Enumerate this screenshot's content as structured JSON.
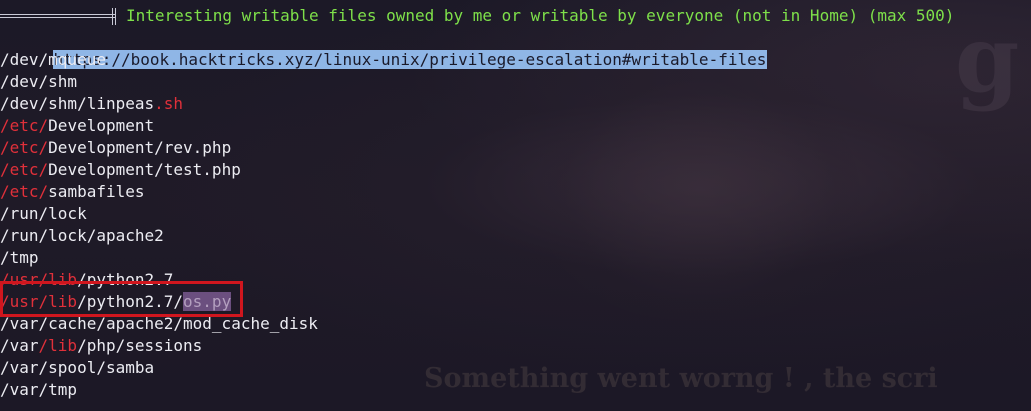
{
  "header": {
    "text": "Interesting writable files owned by me or writable by everyone (not in Home) (max 500)",
    "link": "https://book.hacktricks.xyz/linux-unix/privilege-escalation#writable-files"
  },
  "lines": [
    [
      {
        "t": "/dev/mqueue",
        "c": "white"
      }
    ],
    [
      {
        "t": "/dev/shm",
        "c": "white"
      }
    ],
    [
      {
        "t": "/dev/shm/linpeas",
        "c": "white"
      },
      {
        "t": ".sh",
        "c": "red"
      }
    ],
    [
      {
        "t": "/etc/",
        "c": "red"
      },
      {
        "t": "Development",
        "c": "white"
      }
    ],
    [
      {
        "t": "/etc/",
        "c": "red"
      },
      {
        "t": "Development/rev.php",
        "c": "white"
      }
    ],
    [
      {
        "t": "/etc/",
        "c": "red"
      },
      {
        "t": "Development/test.php",
        "c": "white"
      }
    ],
    [
      {
        "t": "/etc/",
        "c": "red"
      },
      {
        "t": "sambafiles",
        "c": "white"
      }
    ],
    [
      {
        "t": "/run/lock",
        "c": "white"
      }
    ],
    [
      {
        "t": "/run/lock/apache2",
        "c": "white"
      }
    ],
    [
      {
        "t": "/tmp",
        "c": "white"
      }
    ],
    [
      {
        "t": "/usr/lib",
        "c": "red"
      },
      {
        "t": "/python2.7",
        "c": "white"
      }
    ],
    [
      {
        "t": "/usr/lib",
        "c": "red"
      },
      {
        "t": "/python2.7/",
        "c": "white"
      },
      {
        "t": "os.py",
        "c": "hl"
      }
    ],
    [
      {
        "t": "/var/cache/apache2/mod_cache_disk",
        "c": "white"
      }
    ],
    [
      {
        "t": "/var",
        "c": "white"
      },
      {
        "t": "/lib",
        "c": "red"
      },
      {
        "t": "/php/sessions",
        "c": "white"
      }
    ],
    [
      {
        "t": "/var/spool/samba",
        "c": "white"
      }
    ],
    [
      {
        "t": "/var/tmp",
        "c": "white"
      }
    ]
  ],
  "background": {
    "caption": "Something went worng ! , the scri",
    "glyph": "g"
  },
  "colors": {
    "bg": "#1b1826",
    "header_green": "#7ee04a",
    "path_red": "#e0303a",
    "path_white": "#ececf2",
    "link_bg": "#8fb6e6",
    "annotation_red": "#d0161e"
  }
}
